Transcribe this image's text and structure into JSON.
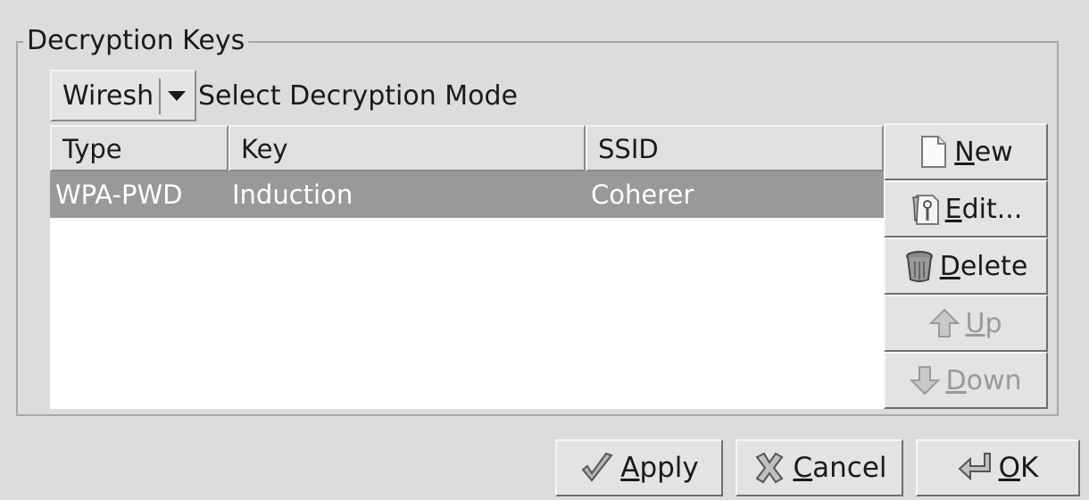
{
  "group": {
    "title": "Decryption Keys"
  },
  "mode": {
    "selected": "Wiresh",
    "label": "Select Decryption Mode"
  },
  "table": {
    "columns": [
      "Type",
      "Key",
      "SSID"
    ],
    "rows": [
      {
        "type": "WPA-PWD",
        "key": "Induction",
        "ssid": "Coherer",
        "selected": true
      }
    ]
  },
  "side_buttons": {
    "new": {
      "prefix": "",
      "accel": "N",
      "rest": "ew",
      "icon": "new-document-icon"
    },
    "edit": {
      "prefix": "",
      "accel": "E",
      "rest": "dit...",
      "icon": "edit-tools-icon"
    },
    "delete": {
      "prefix": "",
      "accel": "D",
      "rest": "elete",
      "icon": "trash-can-icon"
    },
    "up": {
      "prefix": "",
      "accel": "U",
      "rest": "p",
      "icon": "arrow-up-icon",
      "disabled": true
    },
    "down": {
      "prefix": "",
      "accel": "D",
      "rest": "own",
      "icon": "arrow-down-icon",
      "disabled": true
    }
  },
  "dialog_buttons": {
    "apply": {
      "accel": "A",
      "rest": "pply",
      "icon": "checkmark-icon"
    },
    "cancel": {
      "accel": "C",
      "rest": "ancel",
      "icon": "cross-icon"
    },
    "ok": {
      "accel": "O",
      "rest": "K",
      "icon": "enter-return-icon"
    }
  },
  "colors": {
    "selected_row": "#999999",
    "disabled_text": "#9a9a9a",
    "background": "#dcdcdc"
  }
}
